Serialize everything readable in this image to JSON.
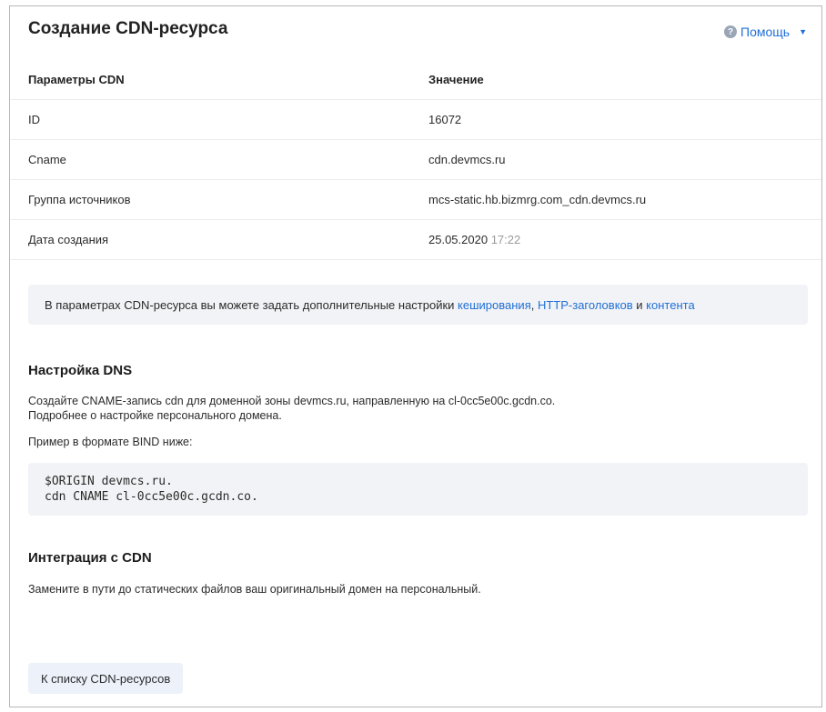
{
  "header": {
    "title": "Создание CDN-ресурса",
    "help_label": "Помощь",
    "help_icon": "help-circle-icon",
    "caret_icon": "caret-down-icon"
  },
  "table": {
    "columns": [
      "Параметры CDN",
      "Значение"
    ],
    "rows": [
      {
        "param": "ID",
        "value": "16072"
      },
      {
        "param": "Cname",
        "value": "cdn.devmcs.ru"
      },
      {
        "param": "Группа источников",
        "value": "mcs-static.hb.bizmrg.com_cdn.devmcs.ru"
      },
      {
        "param": "Дата создания",
        "date": "25.05.2020",
        "time": "17:22"
      }
    ]
  },
  "info": {
    "prefix": "В параметрах CDN-ресурса вы можете задать дополнительные настройки ",
    "link_caching": "кеширования",
    "sep": ", ",
    "link_headers": "HTTP-заголовков",
    "and": " и ",
    "link_content": "контента"
  },
  "dns": {
    "title": "Настройка DNS",
    "line1": "Создайте CNAME-запись cdn для доменной зоны devmcs.ru, направленную на cl-0cc5e00c.gcdn.co.",
    "line2": "Подробнее о настройке персонального домена.",
    "example_label": "Пример в формате BIND ниже:",
    "code": [
      "$ORIGIN devmcs.ru.",
      "cdn CNAME cl-0cc5e00c.gcdn.co."
    ]
  },
  "integration": {
    "title": "Интеграция с CDN",
    "text": "Замените в пути до статических файлов ваш оригинальный домен на персональный."
  },
  "footer": {
    "back_label": "К списку CDN-ресурсов"
  },
  "colors": {
    "link": "#1f6fd6",
    "muted": "#9a9a9a",
    "panel": "#f2f3f6",
    "button": "#ecf1fa"
  }
}
